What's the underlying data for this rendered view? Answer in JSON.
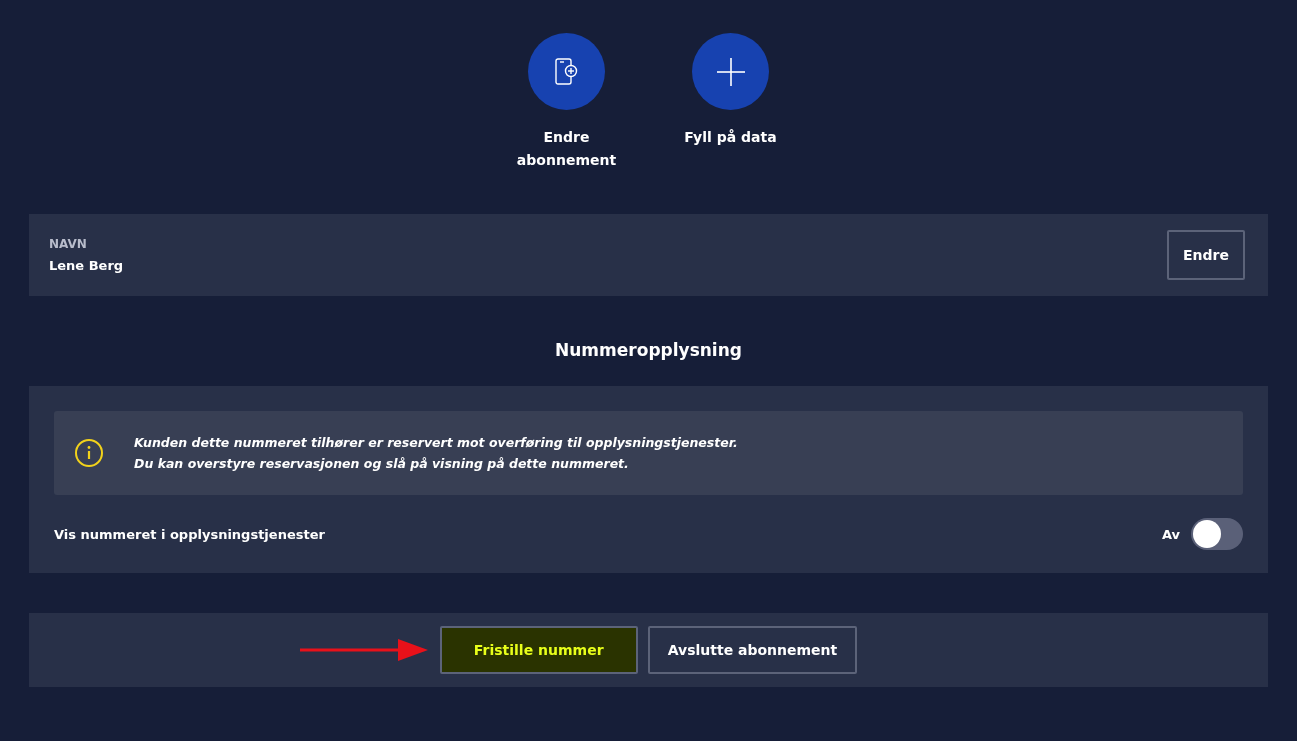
{
  "actions": [
    {
      "kind": "phone-plus",
      "label": "Endre abonnement"
    },
    {
      "kind": "plus",
      "label": "Fyll på data"
    }
  ],
  "name_card": {
    "label": "NAVN",
    "value": "Lene Berg",
    "button": "Endre"
  },
  "directory": {
    "heading": "Nummeropplysning",
    "info_lines": [
      "Kunden dette nummeret tilhører er reservert mot overføring til opplysningstjenester.",
      "Du kan overstyre reservasjonen og slå på visning på dette nummeret."
    ],
    "setting": {
      "label": "Vis nummeret i opplysningstjenester",
      "state_label": "Av",
      "on": false
    }
  },
  "bottom_buttons": [
    {
      "label": "Fristille nummer",
      "highlighted": true
    },
    {
      "label": "Avslutte abonnement",
      "highlighted": false
    }
  ]
}
